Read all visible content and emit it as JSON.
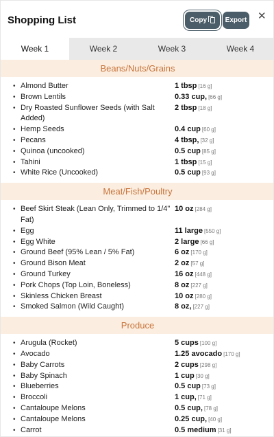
{
  "modal": {
    "title": "Shopping List",
    "copy_label": "Copy",
    "export_label": "Export",
    "close_glyph": "✕"
  },
  "tabs": [
    {
      "label": "Week 1",
      "active": true
    },
    {
      "label": "Week 2",
      "active": false
    },
    {
      "label": "Week 3",
      "active": false
    },
    {
      "label": "Week 4",
      "active": false
    }
  ],
  "sections": [
    {
      "title": "Beans/Nuts/Grains",
      "items": [
        {
          "name": "Almond Butter",
          "qty": "1 tbsp",
          "grams": "[16 g]"
        },
        {
          "name": "Brown Lentils",
          "qty": "0.33 cup,",
          "grams": "[66 g]"
        },
        {
          "name": "Dry Roasted Sunflower Seeds (with Salt Added)",
          "qty": "2 tbsp",
          "grams": "[18 g]"
        },
        {
          "name": "Hemp Seeds",
          "qty": "0.4 cup",
          "grams": "[60 g]"
        },
        {
          "name": "Pecans",
          "qty": "4 tbsp,",
          "grams": "[32 g]"
        },
        {
          "name": "Quinoa (uncooked)",
          "qty": "0.5 cup",
          "grams": "[85 g]"
        },
        {
          "name": "Tahini",
          "qty": "1 tbsp",
          "grams": "[15 g]"
        },
        {
          "name": "White Rice (Uncooked)",
          "qty": "0.5 cup",
          "grams": "[93 g]"
        }
      ]
    },
    {
      "title": "Meat/Fish/Poultry",
      "items": [
        {
          "name": "Beef Skirt Steak (Lean Only, Trimmed to 1/4\" Fat)",
          "qty": "10 oz",
          "grams": "[284 g]"
        },
        {
          "name": "Egg",
          "qty": "11 large",
          "grams": "[550 g]"
        },
        {
          "name": "Egg White",
          "qty": "2 large",
          "grams": "[66 g]"
        },
        {
          "name": "Ground Beef (95% Lean / 5% Fat)",
          "qty": "6 oz",
          "grams": "[170 g]"
        },
        {
          "name": "Ground Bison Meat",
          "qty": "2 oz",
          "grams": "[57 g]"
        },
        {
          "name": "Ground Turkey",
          "qty": "16 oz",
          "grams": "[448 g]"
        },
        {
          "name": "Pork Chops (Top Loin, Boneless)",
          "qty": "8 oz",
          "grams": "[227 g]"
        },
        {
          "name": "Skinless Chicken Breast",
          "qty": "10 oz",
          "grams": "[280 g]"
        },
        {
          "name": "Smoked Salmon (Wild Caught)",
          "qty": "8 oz,",
          "grams": "[227 g]"
        }
      ]
    },
    {
      "title": "Produce",
      "items": [
        {
          "name": "Arugula (Rocket)",
          "qty": "5 cups",
          "grams": "[100 g]"
        },
        {
          "name": "Avocado",
          "qty": "1.25 avocado",
          "grams": "[170 g]"
        },
        {
          "name": "Baby Carrots",
          "qty": "2 cups",
          "grams": "[298 g]"
        },
        {
          "name": "Baby Spinach",
          "qty": "1 cup",
          "grams": "[30 g]"
        },
        {
          "name": "Blueberries",
          "qty": "0.5 cup",
          "grams": "[73 g]"
        },
        {
          "name": "Broccoli",
          "qty": "1 cup,",
          "grams": "[71 g]"
        },
        {
          "name": "Cantaloupe Melons",
          "qty": "0.5 cup,",
          "grams": "[78 g]"
        },
        {
          "name": "Cantaloupe Melons",
          "qty": "0.25 cup,",
          "grams": "[40 g]"
        },
        {
          "name": "Carrot",
          "qty": "0.5 medium",
          "grams": "[31 g]"
        }
      ]
    }
  ]
}
